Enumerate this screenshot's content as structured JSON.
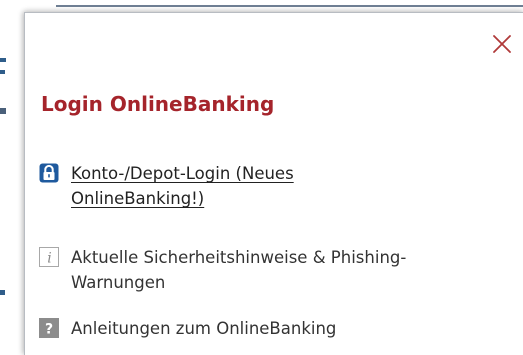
{
  "popup": {
    "close_icon": "close-icon",
    "title": "Login OnlineBanking",
    "items": [
      {
        "icon": "lock-icon",
        "label_line1": "Konto-/Depot-Login (Neues",
        "label_line2": "OnlineBanking!)",
        "is_link": true
      },
      {
        "icon": "info-icon",
        "label_line1": "Aktuelle Sicherheitshinweise & Phishing-",
        "label_line2": "Warnungen",
        "is_link": false
      },
      {
        "icon": "question-icon",
        "label_line1": "Anleitungen zum OnlineBanking",
        "is_link": false
      }
    ]
  },
  "colors": {
    "title": "#a5242b",
    "close": "#b03a3a",
    "lock_icon_bg": "#1f5a9e",
    "question_icon_bg": "#8c8c8c"
  }
}
